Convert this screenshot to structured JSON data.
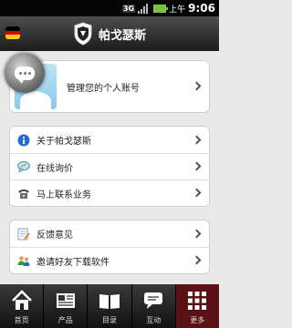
{
  "status_bar": {
    "network": "3G",
    "ampm": "上午",
    "time": "9:06"
  },
  "header": {
    "title": "帕戈瑟斯",
    "flag_icon": "german-flag-icon",
    "logo_icon": "brand-crest-icon"
  },
  "account": {
    "label": "管理您的个人账号",
    "icon": "chat-bubble-icon"
  },
  "menu_group_1": [
    {
      "label": "关于帕戈瑟斯",
      "icon": "info-icon"
    },
    {
      "label": "在线询价",
      "icon": "speech-icon"
    },
    {
      "label": "马上联系业务",
      "icon": "telephone-icon"
    }
  ],
  "menu_group_2": [
    {
      "label": "反馈意见",
      "icon": "note-edit-icon"
    },
    {
      "label": "邀请好友下载软件",
      "icon": "people-icon"
    }
  ],
  "tabs": [
    {
      "label": "首页",
      "icon": "home-icon"
    },
    {
      "label": "产品",
      "icon": "product-icon"
    },
    {
      "label": "目录",
      "icon": "book-icon"
    },
    {
      "label": "互动",
      "icon": "chat-icon"
    },
    {
      "label": "更多",
      "icon": "grid-icon"
    }
  ],
  "colors": {
    "active_tab": "#5a1015",
    "info_blue": "#1c6fd1"
  }
}
